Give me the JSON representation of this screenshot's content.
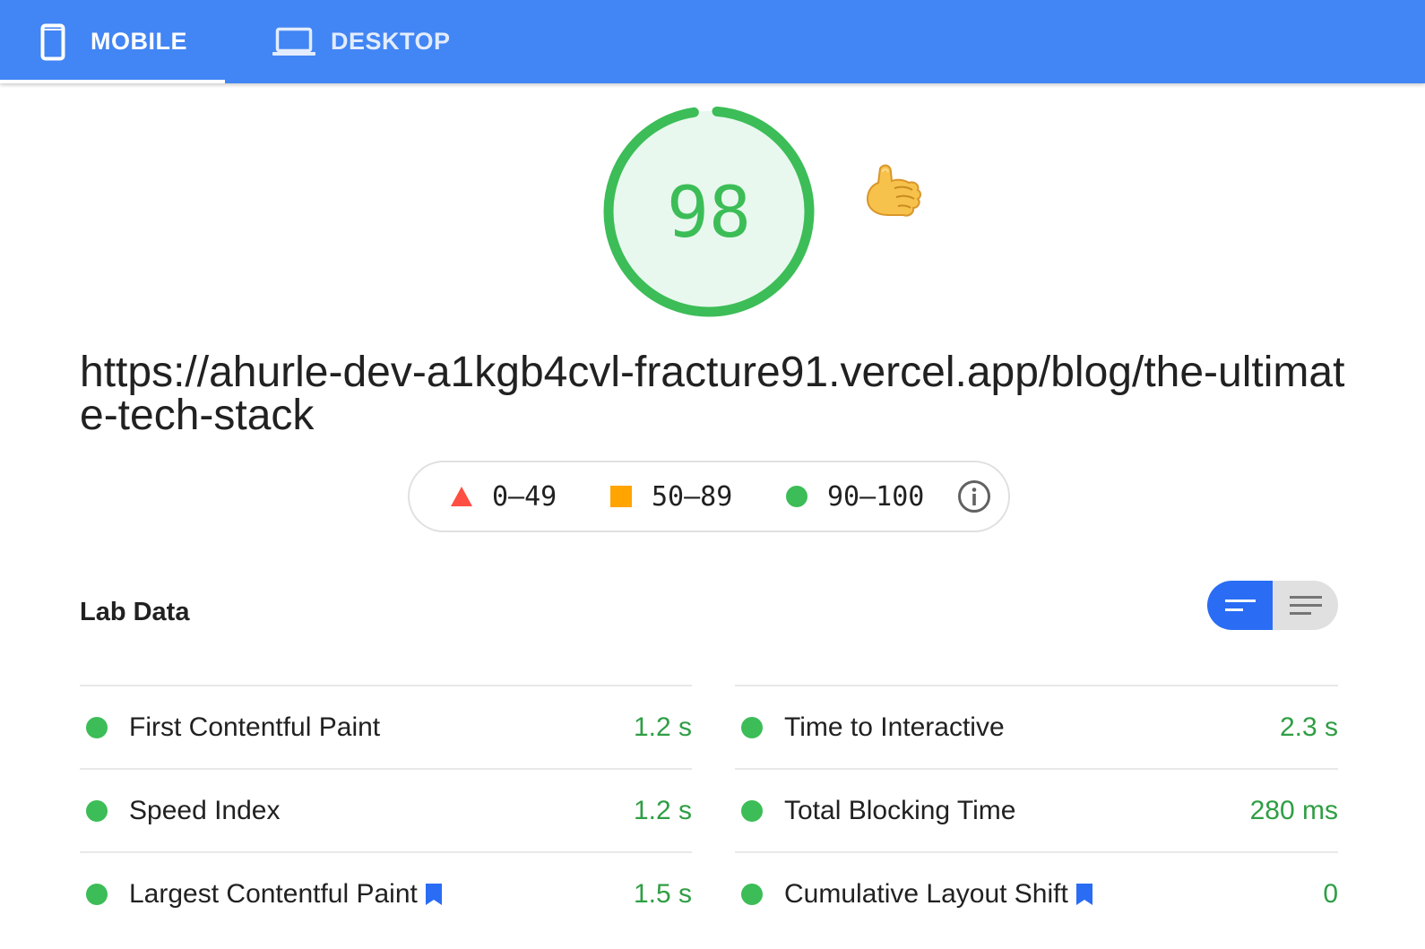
{
  "tabs": [
    {
      "label": "MOBILE",
      "icon": "smartphone-icon",
      "active": true
    },
    {
      "label": "DESKTOP",
      "icon": "laptop-icon",
      "active": false
    }
  ],
  "score": {
    "value": "98",
    "fraction": 0.98,
    "color": "#3cbd57",
    "emoji": "call-me-hand-icon"
  },
  "url": "https://ahurle-dev-a1kgb4cvl-fracture91.vercel.app/blog/the-ultimate-tech-stack",
  "legend": {
    "fail": {
      "range": "0–49",
      "color": "#ff4e42",
      "shape": "triangle"
    },
    "average": {
      "range": "50–89",
      "color": "#ffa400",
      "shape": "square"
    },
    "pass": {
      "range": "90–100",
      "color": "#3cbd57",
      "shape": "circle"
    },
    "info_icon": "info-icon"
  },
  "lab_data": {
    "title": "Lab Data",
    "view_toggle": {
      "active": "summary-view",
      "inactive": "detailed-view"
    },
    "metrics_left": [
      {
        "label": "First Contentful Paint",
        "value": "1.2 s",
        "bookmark": false
      },
      {
        "label": "Speed Index",
        "value": "1.2 s",
        "bookmark": false
      },
      {
        "label": "Largest Contentful Paint",
        "value": "1.5 s",
        "bookmark": true
      }
    ],
    "metrics_right": [
      {
        "label": "Time to Interactive",
        "value": "2.3 s",
        "bookmark": false
      },
      {
        "label": "Total Blocking Time",
        "value": "280 ms",
        "bookmark": false
      },
      {
        "label": "Cumulative Layout Shift",
        "value": "0",
        "bookmark": true
      }
    ]
  },
  "colors": {
    "header": "#4285f4",
    "accent": "#2a6df4",
    "pass": "#3cbd57",
    "value_text": "#2f9e44"
  }
}
